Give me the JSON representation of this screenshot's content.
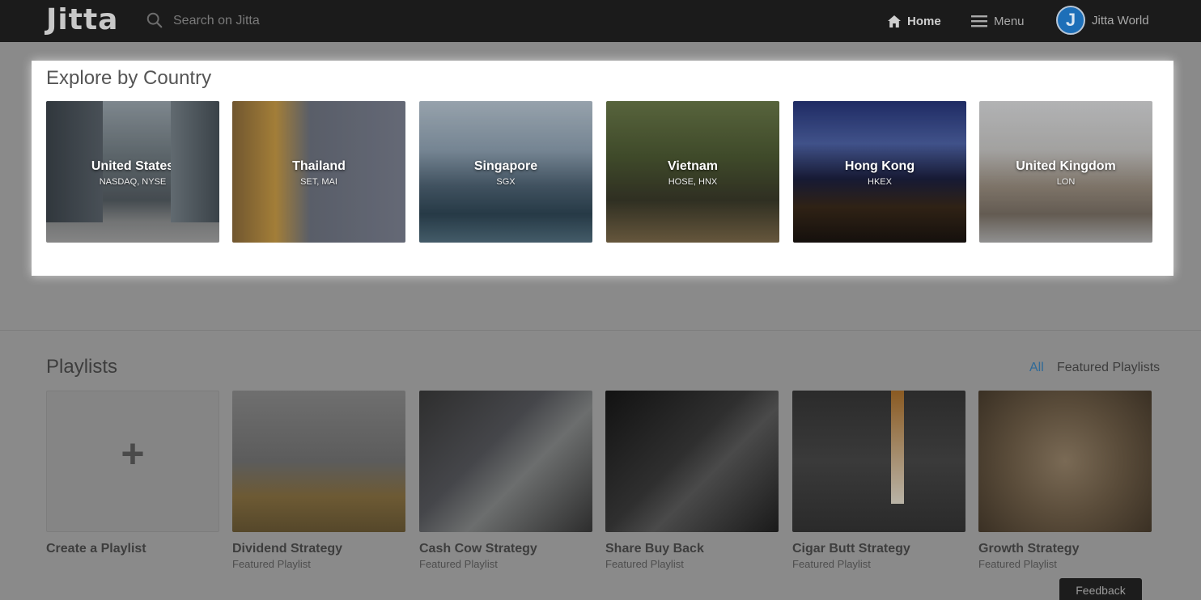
{
  "header": {
    "logo": "Jitta",
    "search_placeholder": "Search on Jitta",
    "nav_home": "Home",
    "nav_menu": "Menu",
    "user_initial": "J",
    "user_name": "Jitta World"
  },
  "explore": {
    "title": "Explore by Country",
    "countries": [
      {
        "name": "United States",
        "exchanges": "NASDAQ, NYSE"
      },
      {
        "name": "Thailand",
        "exchanges": "SET, MAI"
      },
      {
        "name": "Singapore",
        "exchanges": "SGX"
      },
      {
        "name": "Vietnam",
        "exchanges": "HOSE, HNX"
      },
      {
        "name": "Hong Kong",
        "exchanges": "HKEX"
      },
      {
        "name": "United Kingdom",
        "exchanges": "LON"
      }
    ]
  },
  "playlists": {
    "title": "Playlists",
    "filter_all": "All",
    "filter_featured": "Featured Playlists",
    "create_label": "Create a Playlist",
    "items": [
      {
        "title": "Dividend Strategy",
        "subtitle": "Featured Playlist"
      },
      {
        "title": "Cash Cow Strategy",
        "subtitle": "Featured Playlist"
      },
      {
        "title": "Share Buy Back",
        "subtitle": "Featured Playlist"
      },
      {
        "title": "Cigar Butt Strategy",
        "subtitle": "Featured Playlist"
      },
      {
        "title": "Growth Strategy",
        "subtitle": "Featured Playlist"
      }
    ]
  },
  "feedback_label": "Feedback",
  "colors": {
    "nav_bg": "#1b1b1b",
    "page_dim": "#8a8a8a",
    "panel_bg": "#ffffff",
    "link_accent": "#2f6a98",
    "avatar_blue": "#1d6fb8"
  }
}
